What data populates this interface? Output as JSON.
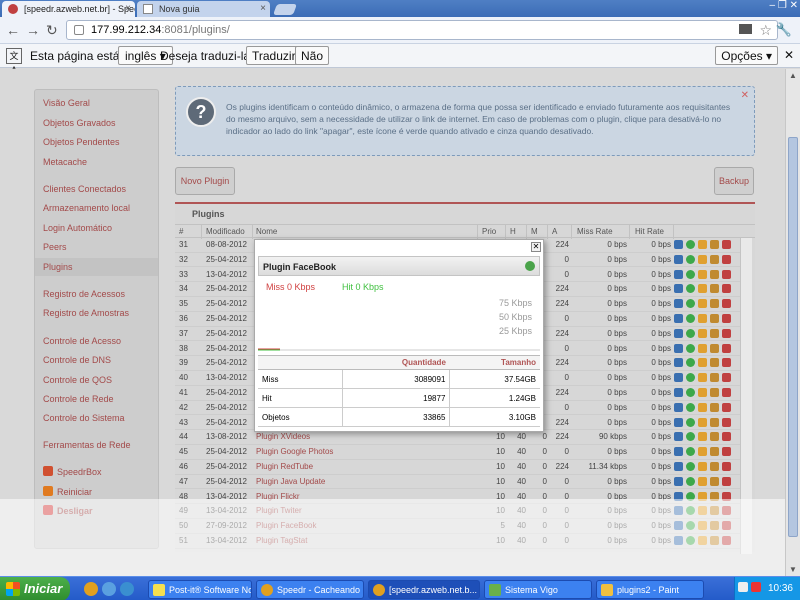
{
  "browser": {
    "tabs": [
      {
        "label": "[speedr.azweb.net.br] - Speedr"
      },
      {
        "label": "Nova guia"
      }
    ],
    "url": {
      "host": "177.99.212.34",
      "path": ":8081/plugins/"
    },
    "window_controls": "– ❐ ✕"
  },
  "translate_bar": {
    "text1": "Esta página está em",
    "language": "inglês ▾",
    "text2": "Deseja traduzi-la?",
    "translate_btn": "Traduzir",
    "no_btn": "Não",
    "options_btn": "Opções ▾"
  },
  "sidebar": {
    "items": [
      {
        "label": "Visão Geral"
      },
      {
        "label": "Objetos Gravados"
      },
      {
        "label": "Objetos Pendentes"
      },
      {
        "label": "Metacache"
      },
      {
        "label": "Clientes Conectados"
      },
      {
        "label": "Armazenamento local"
      },
      {
        "label": "Login Automático"
      },
      {
        "label": "Peers"
      },
      {
        "label": "Plugins"
      },
      {
        "label": "Registro de Acessos"
      },
      {
        "label": "Registro de Amostras"
      },
      {
        "label": "Controle de Acesso"
      },
      {
        "label": "Controle de DNS"
      },
      {
        "label": "Controle de QOS"
      },
      {
        "label": "Controle de Rede"
      },
      {
        "label": "Controle do Sistema"
      },
      {
        "label": "Ferramentas de Rede"
      },
      {
        "label": "SpeedrBox"
      },
      {
        "label": "Reiniciar"
      },
      {
        "label": "Desligar"
      }
    ]
  },
  "info": {
    "text": "Os plugins identificam o conteúdo dinâmico, o armazena de forma que possa ser identificado e enviado futuramente aos requisitantes do mesmo arquivo, sem a necessidade de utilizar o link de internet. Em caso de problemas com o plugin, clique para desativá-lo no indicador ao lado do link \"apagar\", este ícone é verde quando ativado e cinza quando desativado."
  },
  "buttons": {
    "new_plugin": "Novo Plugin",
    "backup": "Backup"
  },
  "plugins": {
    "title": "Plugins",
    "columns": [
      "#",
      "Modificado",
      "Nome",
      "Prio",
      "H",
      "M",
      "A",
      "Miss Rate",
      "Hit Rate"
    ],
    "rows": [
      {
        "id": "31",
        "date": "08-08-2012",
        "name": "",
        "prio": "",
        "h": "",
        "m": "",
        "a": "224",
        "miss": "0 bps",
        "hit": "0 bps"
      },
      {
        "id": "32",
        "date": "25-04-2012",
        "name": "",
        "prio": "",
        "h": "",
        "m": "",
        "a": "0",
        "miss": "0 bps",
        "hit": "0 bps"
      },
      {
        "id": "33",
        "date": "13-04-2012",
        "name": "",
        "prio": "",
        "h": "",
        "m": "",
        "a": "0",
        "miss": "0 bps",
        "hit": "0 bps"
      },
      {
        "id": "34",
        "date": "25-04-2012",
        "name": "",
        "prio": "",
        "h": "",
        "m": "",
        "a": "224",
        "miss": "0 bps",
        "hit": "0 bps"
      },
      {
        "id": "35",
        "date": "25-04-2012",
        "name": "",
        "prio": "",
        "h": "",
        "m": "",
        "a": "224",
        "miss": "0 bps",
        "hit": "0 bps"
      },
      {
        "id": "36",
        "date": "25-04-2012",
        "name": "",
        "prio": "",
        "h": "",
        "m": "",
        "a": "0",
        "miss": "0 bps",
        "hit": "0 bps"
      },
      {
        "id": "37",
        "date": "25-04-2012",
        "name": "",
        "prio": "",
        "h": "",
        "m": "",
        "a": "224",
        "miss": "0 bps",
        "hit": "0 bps"
      },
      {
        "id": "38",
        "date": "25-04-2012",
        "name": "",
        "prio": "",
        "h": "",
        "m": "",
        "a": "0",
        "miss": "0 bps",
        "hit": "0 bps"
      },
      {
        "id": "39",
        "date": "25-04-2012",
        "name": "",
        "prio": "",
        "h": "",
        "m": "",
        "a": "224",
        "miss": "0 bps",
        "hit": "0 bps"
      },
      {
        "id": "40",
        "date": "13-04-2012",
        "name": "",
        "prio": "",
        "h": "",
        "m": "",
        "a": "0",
        "miss": "0 bps",
        "hit": "0 bps"
      },
      {
        "id": "41",
        "date": "25-04-2012",
        "name": "",
        "prio": "",
        "h": "",
        "m": "",
        "a": "224",
        "miss": "0 bps",
        "hit": "0 bps"
      },
      {
        "id": "42",
        "date": "25-04-2012",
        "name": "",
        "prio": "",
        "h": "",
        "m": "",
        "a": "0",
        "miss": "0 bps",
        "hit": "0 bps"
      },
      {
        "id": "43",
        "date": "25-04-2012",
        "name": "",
        "prio": "",
        "h": "",
        "m": "",
        "a": "224",
        "miss": "0 bps",
        "hit": "0 bps"
      },
      {
        "id": "44",
        "date": "13-08-2012",
        "name": "Plugin XVideos",
        "prio": "10",
        "h": "40",
        "m": "0",
        "a": "224",
        "miss": "90 kbps",
        "hit": "0 bps"
      },
      {
        "id": "45",
        "date": "25-04-2012",
        "name": "Plugin Google Photos",
        "prio": "10",
        "h": "40",
        "m": "0",
        "a": "0",
        "miss": "0 bps",
        "hit": "0 bps"
      },
      {
        "id": "46",
        "date": "25-04-2012",
        "name": "Plugin RedTube",
        "prio": "10",
        "h": "40",
        "m": "0",
        "a": "224",
        "miss": "11.34 kbps",
        "hit": "0 bps"
      },
      {
        "id": "47",
        "date": "25-04-2012",
        "name": "Plugin Java Update",
        "prio": "10",
        "h": "40",
        "m": "0",
        "a": "0",
        "miss": "0 bps",
        "hit": "0 bps"
      },
      {
        "id": "48",
        "date": "13-04-2012",
        "name": "Plugin Flickr",
        "prio": "10",
        "h": "40",
        "m": "0",
        "a": "0",
        "miss": "0 bps",
        "hit": "0 bps"
      },
      {
        "id": "49",
        "date": "13-04-2012",
        "name": "Plugin Twiter",
        "prio": "10",
        "h": "40",
        "m": "0",
        "a": "0",
        "miss": "0 bps",
        "hit": "0 bps"
      },
      {
        "id": "50",
        "date": "27-09-2012",
        "name": "Plugin FaceBook",
        "prio": "5",
        "h": "40",
        "m": "0",
        "a": "0",
        "miss": "0 bps",
        "hit": "0 bps"
      },
      {
        "id": "51",
        "date": "13-04-2012",
        "name": "Plugin TagStat",
        "prio": "10",
        "h": "40",
        "m": "0",
        "a": "0",
        "miss": "0 bps",
        "hit": "0 bps"
      }
    ]
  },
  "popup": {
    "title": "Plugin FaceBook",
    "close": "✕",
    "legend_miss": "Miss 0 Kbps",
    "legend_hit": "Hit 0 Kbps",
    "y_ticks": [
      "75 Kbps",
      "50 Kbps",
      "25 Kbps"
    ],
    "table": {
      "headers": [
        "",
        "Quantidade",
        "Tamanho"
      ],
      "rows": [
        {
          "label": "Miss",
          "qty": "3089091",
          "size": "37.54GB"
        },
        {
          "label": "Hit",
          "qty": "19877",
          "size": "1.24GB"
        },
        {
          "label": "Objetos",
          "qty": "33865",
          "size": "3.10GB"
        }
      ]
    }
  },
  "taskbar": {
    "start": "Iniciar",
    "tasks": [
      {
        "label": "Post-it® Software No..."
      },
      {
        "label": "Speedr - Cacheando ..."
      },
      {
        "label": "[speedr.azweb.net.b..."
      },
      {
        "label": "Sistema Vigo"
      },
      {
        "label": "plugins2 - Paint"
      }
    ],
    "clock": "10:36"
  },
  "colors": {
    "accent": "#a34a4a",
    "miss": "#d04040",
    "hit": "#40c040"
  }
}
